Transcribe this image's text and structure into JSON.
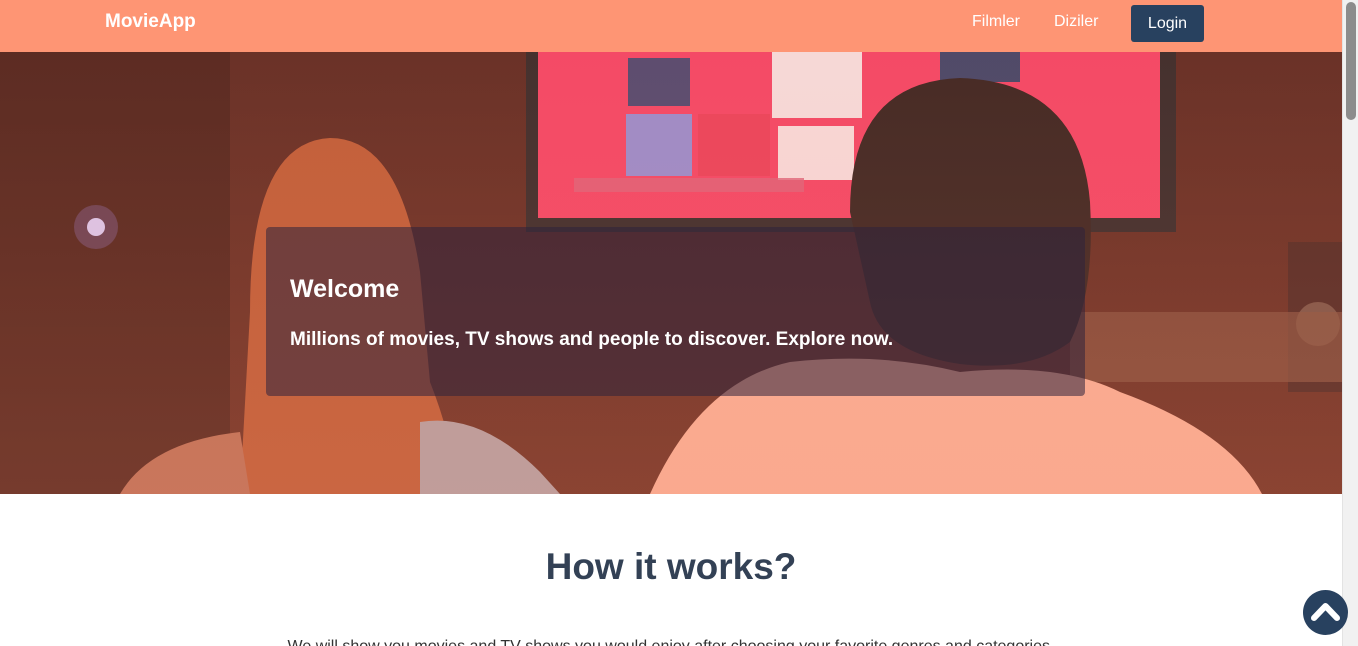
{
  "navbar": {
    "brand": "MovieApp",
    "links": [
      "Filmler",
      "Diziler"
    ],
    "login_label": "Login",
    "background_color": "#fe9574",
    "button_color": "#28415f"
  },
  "hero": {
    "title": "Welcome",
    "subtitle": "Millions of movies, TV shows and people to discover. Explore now."
  },
  "how_it_works": {
    "title": "How it works?",
    "text": "We will show you movies and TV shows you would enjoy after choosing your favorite genres and categories."
  },
  "icons": {
    "scroll_top": "chevron-up-icon"
  }
}
